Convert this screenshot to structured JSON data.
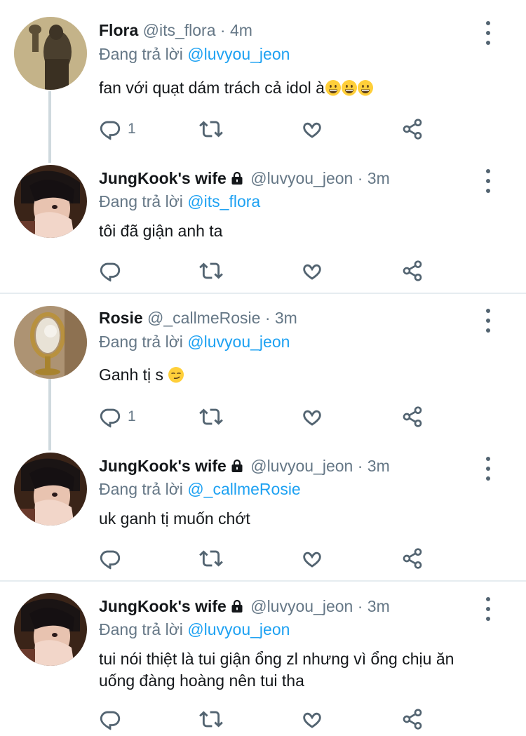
{
  "tweets": [
    {
      "name": "Flora",
      "locked": false,
      "handle": "@its_flora",
      "time": "4m",
      "reply_prefix": "Đang trả lời",
      "reply_to": "@luvyou_jeon",
      "text": "fan với quạt dám trách cả idol à",
      "emoji": [
        "grinning-face-emoji",
        "grinning-face-emoji",
        "grinning-face-emoji"
      ],
      "reply_count": "1",
      "avatar": "silhouette-photo"
    },
    {
      "name": "JungKook's wife",
      "locked": true,
      "handle": "@luvyou_jeon",
      "time": "3m",
      "reply_prefix": "Đang trả lời",
      "reply_to": "@its_flora",
      "text": "tôi đã giận anh ta",
      "reply_count": "",
      "avatar": "girl-portrait-photo"
    },
    {
      "name": "Rosie",
      "locked": false,
      "handle": "@_callmeRosie",
      "time": "3m",
      "reply_prefix": "Đang trả lời",
      "reply_to": "@luvyou_jeon",
      "text": "Ganh tị s",
      "emoji": [
        "smirking-face-emoji"
      ],
      "reply_count": "1",
      "avatar": "mirror-photo"
    },
    {
      "name": "JungKook's wife",
      "locked": true,
      "handle": "@luvyou_jeon",
      "time": "3m",
      "reply_prefix": "Đang trả lời",
      "reply_to": "@_callmeRosie",
      "text": "uk ganh tị muốn chớt",
      "reply_count": "",
      "avatar": "girl-portrait-photo"
    },
    {
      "name": "JungKook's wife",
      "locked": true,
      "handle": "@luvyou_jeon",
      "time": "3m",
      "reply_prefix": "Đang trả lời",
      "reply_to": "@luvyou_jeon",
      "text": "tui nói thiệt là tui giận ổng zl nhưng vì ổng chịu ăn uống đàng hoàng nên tui tha",
      "reply_count": "",
      "avatar": "girl-portrait-photo"
    }
  ],
  "separator_dot": "·",
  "icons": [
    "reply-icon",
    "retweet-icon",
    "like-icon",
    "share-icon",
    "more-icon",
    "lock-icon"
  ],
  "colors": {
    "link": "#1da1f2",
    "muted": "#657786",
    "text": "#14171a",
    "separator": "#e6ecf0",
    "thread": "#cfd9de"
  }
}
